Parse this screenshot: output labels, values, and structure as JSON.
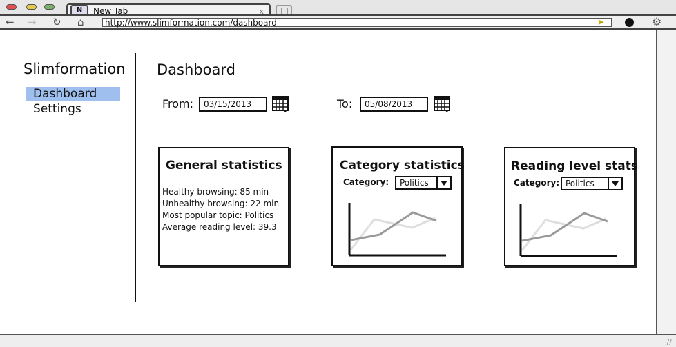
{
  "browser": {
    "tab_title": "New Tab",
    "tab_close": "x",
    "favicon_letter": "N",
    "url": "http://www.slimformation.com/dashboard",
    "icons": [
      "back-icon",
      "forward-icon",
      "reload-icon",
      "home-icon",
      "go-icon",
      "extension-icon",
      "settings-gear-icon"
    ]
  },
  "sidebar": {
    "brand": "Slimformation",
    "items": [
      {
        "label": "Dashboard",
        "active": true
      },
      {
        "label": "Settings",
        "active": false
      }
    ],
    "active_color": "#9fc0ef"
  },
  "main": {
    "title": "Dashboard",
    "from_label": "From:",
    "from_value": "03/15/2013",
    "to_label": "To:",
    "to_value": "05/08/2013"
  },
  "general": {
    "title": "General statistics",
    "lines": [
      "Healthy browsing: 85 min",
      "Unhealthy browsing: 22 min",
      "Most popular topic: Politics",
      "Average reading level: 39.3"
    ]
  },
  "category": {
    "title": "Category statistics",
    "filter_label": "Category:",
    "filter_value": "Politics"
  },
  "reading": {
    "title": "Reading level stats",
    "filter_label": "Category:",
    "filter_value": "Politics"
  }
}
